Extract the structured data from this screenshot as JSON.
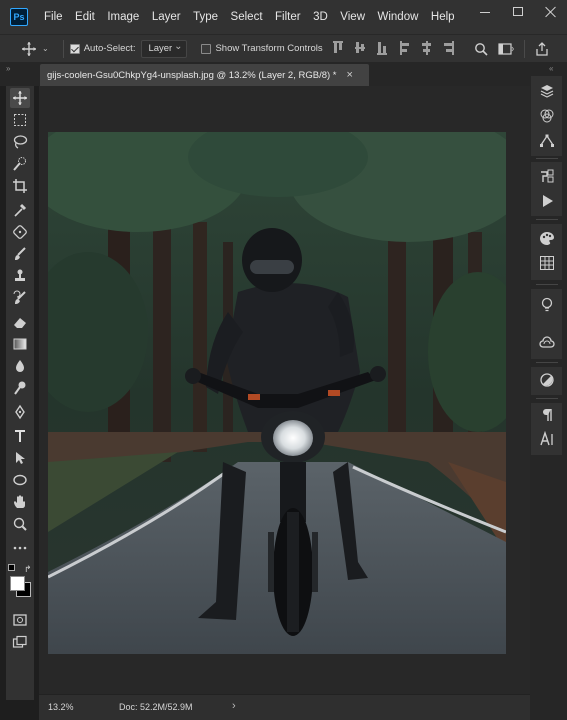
{
  "app": {
    "logo_text": "Ps",
    "accent": "#31a8ff"
  },
  "menu": {
    "items": [
      "File",
      "Edit",
      "Image",
      "Layer",
      "Type",
      "Select",
      "Filter",
      "3D",
      "View",
      "Window",
      "Help"
    ]
  },
  "window_controls": {
    "icons": [
      "minimize-icon",
      "maximize-icon",
      "close-icon"
    ]
  },
  "options_bar": {
    "auto_select_label": "Auto-Select:",
    "auto_select_checked": true,
    "auto_select_target": "Layer",
    "transform_controls_label": "Show Transform Controls",
    "transform_controls_checked": false
  },
  "document": {
    "tab_title": "gijs-coolen-Gsu0ChkpYg4-unsplash.jpg @ 13.2% (Layer 2, RGB/8) *",
    "close_glyph": "×"
  },
  "toolbar": {
    "tools": [
      "move-tool",
      "marquee-tool",
      "lasso-tool",
      "quick-selection-tool",
      "crop-tool",
      "eyedropper-tool",
      "healing-brush-tool",
      "brush-tool",
      "clone-stamp-tool",
      "history-brush-tool",
      "eraser-tool",
      "gradient-tool",
      "blur-tool",
      "dodge-tool",
      "pen-tool",
      "type-tool",
      "path-selection-tool",
      "ellipse-tool",
      "hand-tool",
      "zoom-tool",
      "more-tools",
      "color-swatches",
      "quick-mask",
      "screen-mode"
    ],
    "foreground_color": "#ffffff",
    "background_color": "#000000"
  },
  "status_bar": {
    "zoom": "13.2%",
    "doc_size": "Doc: 52.2M/52.9M",
    "arrow": "›"
  },
  "right_panel": {
    "icons": [
      "layers-icon",
      "channels-icon",
      "paths-icon",
      "history-icon",
      "actions-icon",
      "color-icon",
      "swatches-icon",
      "learn-icon",
      "libraries-icon",
      "adjustments-icon",
      "paragraph-icon",
      "character-icon"
    ]
  }
}
